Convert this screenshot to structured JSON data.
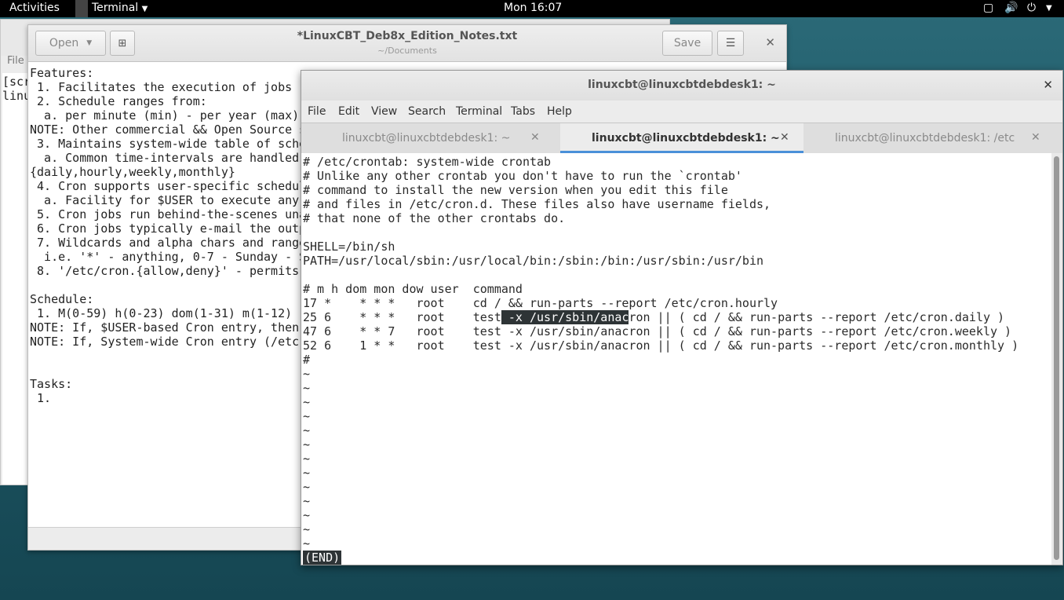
{
  "topbar": {
    "activities": "Activities",
    "app_menu": "Terminal",
    "clock": "Mon 16:07"
  },
  "bg_terminal": {
    "menu_file": "File",
    "lines": [
      "[scr",
      "linu"
    ]
  },
  "gedit": {
    "open_label": "Open",
    "save_label": "Save",
    "title": "*LinuxCBT_Deb8x_Edition_Notes.txt",
    "subtitle": "~/Documents",
    "lines": [
      "Features:",
      " 1. Facilitates the execution of jobs (",
      " 2. Schedule ranges from:",
      "  a. per minute (min) - per year (max)",
      "NOTE: Other commercial && Open Source s",
      " 3. Maintains system-wide table of sche",
      "  a. Common time-intervals are handled",
      "{daily,hourly,weekly,monthly}",
      " 4. Cron supports user-specific schedul",
      "  a. Facility for $USER to execute any",
      " 5. Cron jobs run behind-the-scenes una",
      " 6. Cron jobs typically e-mail the outp",
      " 7. Wildcards and alpha chars and range",
      "  i.e. '*' - anything, 0-7 - Sunday - S",
      " 8. '/etc/cron.{allow,deny}' - permits",
      "",
      "Schedule:",
      " 1. M(0-59) h(0-23) dom(1-31) m(1-12) (",
      "NOTE: If, $USER-based Cron entry, then",
      "NOTE: If, System-wide Cron entry (/etc",
      "",
      "",
      "Tasks:",
      " 1."
    ]
  },
  "terminal": {
    "title": "linuxcbt@linuxcbtdebdesk1: ~",
    "menu": [
      "File",
      "Edit",
      "View",
      "Search",
      "Terminal",
      "Tabs",
      "Help"
    ],
    "tabs": [
      {
        "label": "linuxcbt@linuxcbtdebdesk1: ~"
      },
      {
        "label": "linuxcbt@linuxcbtdebdesk1: ~"
      },
      {
        "label": "linuxcbt@linuxcbtdebdesk1: /etc"
      }
    ],
    "lines": [
      "# /etc/crontab: system-wide crontab",
      "# Unlike any other crontab you don't have to run the `crontab'",
      "# command to install the new version when you edit this file",
      "# and files in /etc/cron.d. These files also have username fields,",
      "# that none of the other crontabs do.",
      "",
      "SHELL=/bin/sh",
      "PATH=/usr/local/sbin:/usr/local/bin:/sbin:/bin:/usr/sbin:/usr/bin",
      "",
      "# m h dom mon dow user  command",
      "17 *    * * *   root    cd / && run-parts --report /etc/cron.hourly",
      "25 6    * * *   root    test -x /usr/sbin/anacron || ( cd / && run-parts --report /etc/cron.daily )",
      "47 6    * * 7   root    test -x /usr/sbin/anacron || ( cd / && run-parts --report /etc/cron.weekly )",
      "52 6    1 * *   root    test -x /usr/sbin/anacron || ( cd / && run-parts --report /etc/cron.monthly )",
      "#",
      "~",
      "~",
      "~",
      "~",
      "~",
      "~",
      "~",
      "~",
      "~",
      "~",
      "~",
      "~",
      "~"
    ],
    "selected_line_prefix": "25 6    * * *   root    test",
    "selected_text": " -x /usr/sbin/anac",
    "selected_line_suffix": "ron || ( cd / && run-parts --report /etc/cron.daily )",
    "status": "(END)"
  }
}
